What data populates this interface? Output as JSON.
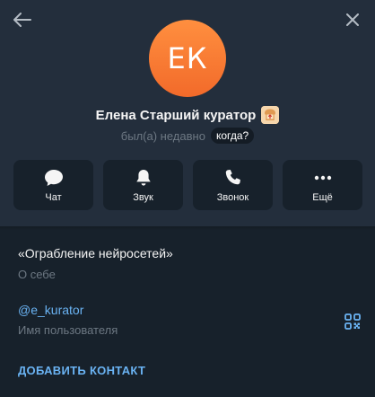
{
  "header": {
    "back_icon": "arrow-left-icon",
    "close_icon": "close-icon"
  },
  "profile": {
    "initials": "ЕК",
    "name": "Елена Старший куратор",
    "emoji_icon": "toast-emoji-icon",
    "status": "был(а) недавно",
    "when_label": "когда?",
    "avatar_gradient": [
      "#ff8f3f",
      "#f26a2a"
    ]
  },
  "actions": [
    {
      "label": "Чат",
      "icon": "chat-bubble-icon"
    },
    {
      "label": "Звук",
      "icon": "bell-icon"
    },
    {
      "label": "Звонок",
      "icon": "phone-icon"
    },
    {
      "label": "Ещё",
      "icon": "more-dots-icon"
    }
  ],
  "info": {
    "bio": "«Ограбление нейросетей»",
    "bio_caption": "О себе",
    "username": "@e_kurator",
    "username_caption": "Имя пользователя",
    "qr_icon": "qr-code-icon"
  },
  "add_contact_label": "ДОБАВИТЬ КОНТАКТ",
  "colors": {
    "background": "#17212b",
    "header_bg": "#232e3c",
    "accent": "#6ab3f3",
    "muted": "#6d7883"
  }
}
